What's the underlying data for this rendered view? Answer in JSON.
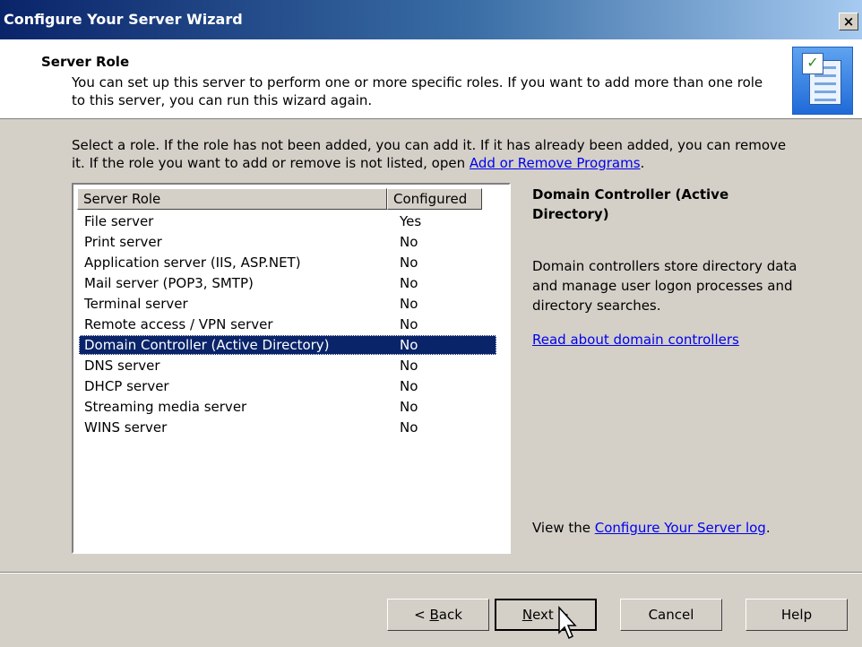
{
  "window": {
    "title": "Configure Your Server Wizard",
    "close_glyph": "×"
  },
  "header": {
    "title": "Server Role",
    "subtitle": "You can set up this server to perform one or more specific roles. If you want to add more than one role to this server, you can run this wizard again.",
    "icon": "server-checklist-icon"
  },
  "instructions": {
    "text": "Select a role. If the role has not been added, you can add it. If it has already been added, you can remove it. If the role you want to add or remove is not listed, open ",
    "link": "Add or Remove Programs",
    "end": "."
  },
  "table": {
    "columns": [
      "Server Role",
      "Configured"
    ],
    "rows": [
      {
        "role": "File server",
        "configured": "Yes"
      },
      {
        "role": "Print server",
        "configured": "No"
      },
      {
        "role": "Application server (IIS, ASP.NET)",
        "configured": "No"
      },
      {
        "role": "Mail server (POP3, SMTP)",
        "configured": "No"
      },
      {
        "role": "Terminal server",
        "configured": "No"
      },
      {
        "role": "Remote access / VPN server",
        "configured": "No"
      },
      {
        "role": "Domain Controller (Active Directory)",
        "configured": "No"
      },
      {
        "role": "DNS server",
        "configured": "No"
      },
      {
        "role": "DHCP server",
        "configured": "No"
      },
      {
        "role": "Streaming media server",
        "configured": "No"
      },
      {
        "role": "WINS server",
        "configured": "No"
      }
    ],
    "selected_index": 6
  },
  "detail": {
    "title": "Domain Controller (Active Directory)",
    "description": "Domain controllers store directory data and manage user logon processes and directory searches.",
    "link": "Read about domain controllers"
  },
  "log": {
    "prefix": "View the ",
    "link": "Configure Your Server log",
    "suffix": "."
  },
  "buttons": {
    "back": {
      "pre": "< ",
      "accel": "B",
      "rest": "ack"
    },
    "next": {
      "accel": "N",
      "rest": "ext >"
    },
    "cancel": "Cancel",
    "help": "Help"
  },
  "colors": {
    "selection": "#0a246a",
    "dialog": "#d4d0c8",
    "link": "#0000ee"
  }
}
